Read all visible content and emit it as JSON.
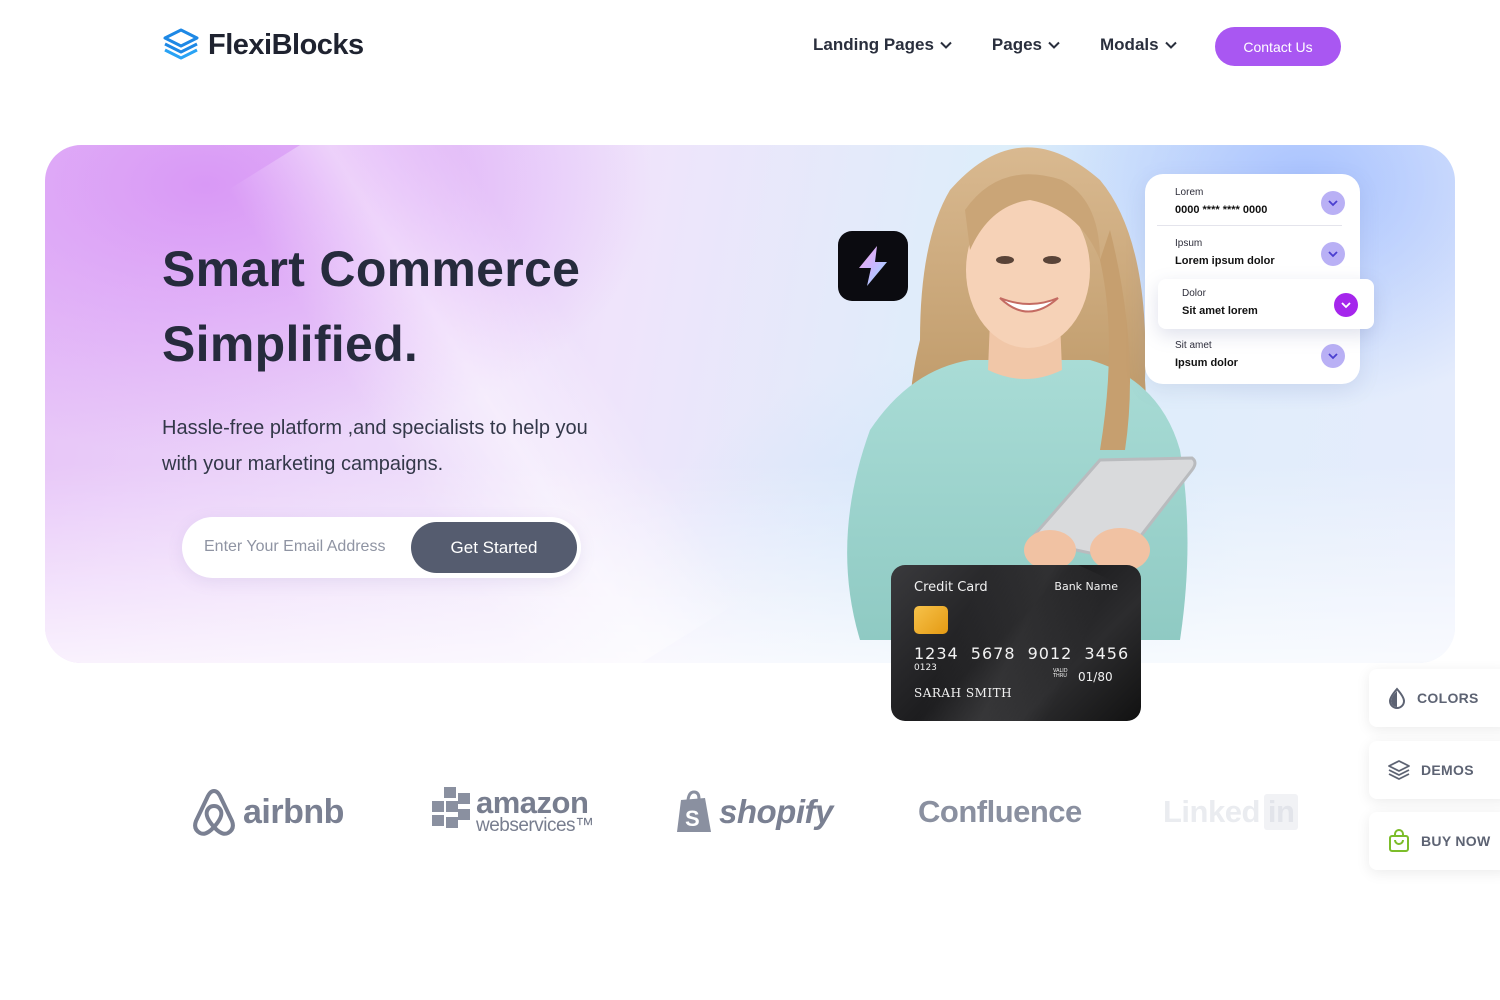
{
  "brand": {
    "logo_text": "FlexiBlocks"
  },
  "nav": {
    "items": [
      {
        "label": "Landing Pages"
      },
      {
        "label": "Pages"
      },
      {
        "label": "Modals"
      }
    ],
    "contact_label": "Contact Us"
  },
  "hero": {
    "title_line1": "Smart Commerce",
    "title_line2": "Simplified.",
    "subtitle": "Hassle-free platform ,and specialists to help you with your marketing campaigns.",
    "email_placeholder": "Enter Your Email Address",
    "cta_label": "Get Started"
  },
  "dropdown_card": {
    "rows": [
      {
        "label": "Lorem",
        "value": "0000 **** **** 0000"
      },
      {
        "label": "Ipsum",
        "value": "Lorem ipsum dolor"
      },
      {
        "label": "Dolor",
        "value": "Sit amet lorem"
      },
      {
        "label": "Sit amet",
        "value": "Ipsum dolor"
      }
    ]
  },
  "credit_card": {
    "title": "Credit Card",
    "bank": "Bank Name",
    "number": "1234 5678 9012 3456",
    "small_number": "0123",
    "valid_label": "VALID THRU",
    "expiry": "01/80",
    "holder": "SARAH SMITH"
  },
  "side_panel": {
    "colors_label": "COLORS",
    "demos_label": "DEMOS",
    "buy_label": "BUY NOW"
  },
  "partners": {
    "airbnb": "airbnb",
    "amazon_main": "amazon",
    "amazon_sub": "webservices™",
    "shopify": "shopify",
    "confluence": "Confluence",
    "linkedin_a": "Linked",
    "linkedin_b": "in"
  },
  "colors": {
    "accent": "#a957f2",
    "button_dark": "#555c6f",
    "heading": "#262b3d"
  }
}
